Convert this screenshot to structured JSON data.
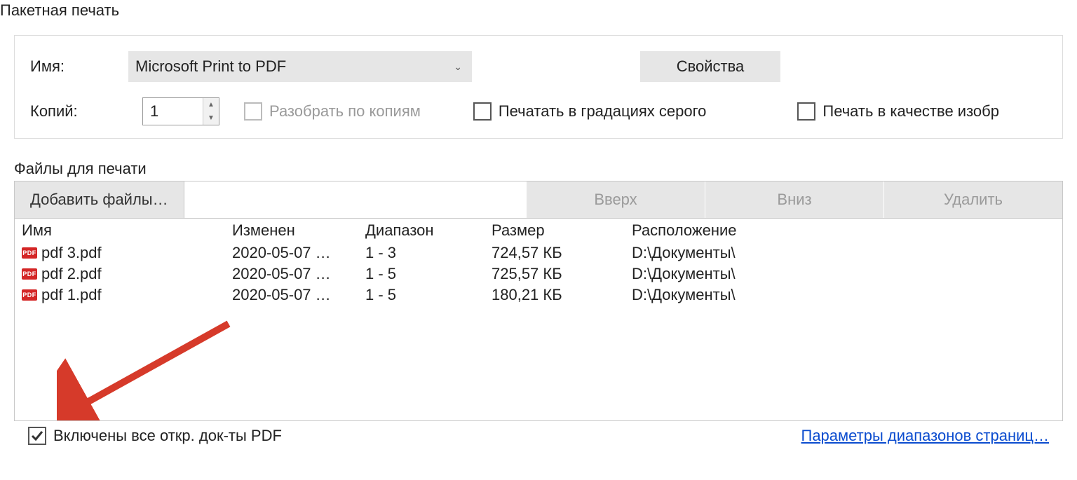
{
  "window_title": "Пакетная печать",
  "printer": {
    "name_label": "Имя:",
    "selected": "Microsoft Print to PDF",
    "properties_button": "Свойства"
  },
  "copies": {
    "label": "Копий:",
    "value": "1",
    "collate_label": "Разобрать по копиям",
    "grayscale_label": "Печатать в градациях серого",
    "as_image_label": "Печать в качестве изобр"
  },
  "files_section": {
    "title": "Файлы для печати",
    "add_button": "Добавить файлы…",
    "up_button": "Вверх",
    "down_button": "Вниз",
    "delete_button": "Удалить",
    "columns": {
      "name": "Имя",
      "modified": "Изменен",
      "range": "Диапазон",
      "size": "Размер",
      "location": "Расположение"
    },
    "rows": [
      {
        "name": "pdf 3.pdf",
        "modified": "2020-05-07 …",
        "range": "1 - 3",
        "size": "724,57 КБ",
        "location": "D:\\Документы\\"
      },
      {
        "name": "pdf 2.pdf",
        "modified": "2020-05-07 …",
        "range": "1 - 5",
        "size": "725,57 КБ",
        "location": "D:\\Документы\\"
      },
      {
        "name": "pdf 1.pdf",
        "modified": "2020-05-07 …",
        "range": "1 - 5",
        "size": "180,21 КБ",
        "location": "D:\\Документы\\"
      }
    ]
  },
  "bottom": {
    "include_open_label": "Включены все откр. док-ты PDF",
    "page_range_link": "Параметры диапазонов страниц…"
  }
}
